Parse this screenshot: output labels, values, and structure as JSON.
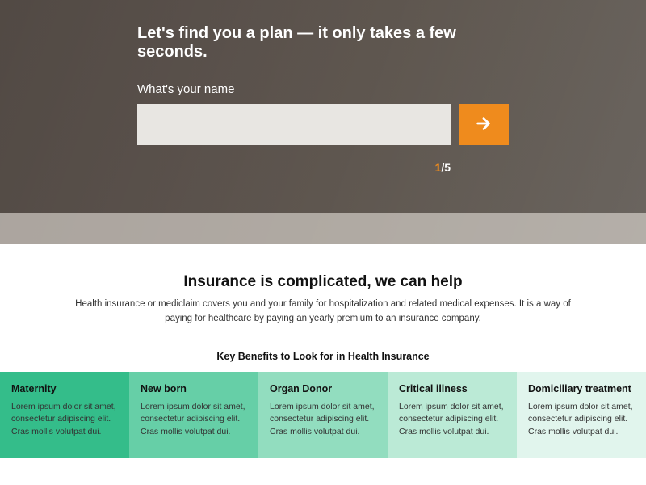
{
  "hero": {
    "title": "Let's find you a plan — it only takes a few seconds.",
    "label": "What's your name",
    "input_value": "",
    "input_placeholder": "",
    "step_current": "1",
    "step_sep": "/",
    "step_total": "5"
  },
  "mid": {
    "title": "Insurance is complicated, we can help",
    "subtitle": "Health insurance or mediclaim covers you and your family for hospitalization and related medical expenses. It is a way of paying for healthcare by paying an yearly premium to an insurance company."
  },
  "benefits": {
    "heading": "Key Benefits to Look for in Health Insurance",
    "items": [
      {
        "title": "Maternity",
        "body": "Lorem ipsum dolor sit amet, consectetur adipiscing elit. Cras mollis volutpat dui."
      },
      {
        "title": "New born",
        "body": "Lorem ipsum dolor sit amet, consectetur adipiscing elit. Cras mollis volutpat dui."
      },
      {
        "title": "Organ Donor",
        "body": "Lorem ipsum dolor sit amet, consectetur adipiscing elit. Cras mollis volutpat dui."
      },
      {
        "title": "Critical illness",
        "body": "Lorem ipsum dolor sit amet, consectetur adipiscing elit. Cras mollis volutpat dui."
      },
      {
        "title": "Domiciliary treatment",
        "body": "Lorem ipsum dolor sit amet, consectetur adipiscing elit. Cras mollis volutpat dui."
      }
    ]
  },
  "colors": {
    "accent": "#ef8b1d",
    "benefit_shades": [
      "#34bd8a",
      "#66cfa7",
      "#92ddbf",
      "#bbead6",
      "#e1f5ed"
    ]
  }
}
